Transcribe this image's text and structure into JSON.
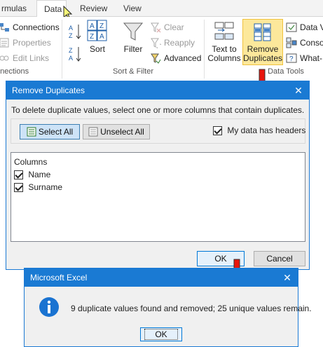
{
  "ribbon": {
    "tabs": [
      {
        "label": "rmulas"
      },
      {
        "label": "Data"
      },
      {
        "label": "Review"
      },
      {
        "label": "View"
      }
    ],
    "connections_group": {
      "items": [
        "Connections",
        "Properties",
        "Edit Links"
      ],
      "label": "nnections"
    },
    "sort_filter_group": {
      "sort_label": "Sort",
      "filter_label": "Filter",
      "clear_label": "Clear",
      "reapply_label": "Reapply",
      "advanced_label": "Advanced",
      "label": "Sort & Filter"
    },
    "data_tools_group": {
      "text_to_columns_line1": "Text to",
      "text_to_columns_line2": "Columns",
      "remove_duplicates_line1": "Remove",
      "remove_duplicates_line2": "Duplicates",
      "right_items": [
        "Data V",
        "Conso",
        "What-I"
      ],
      "label": "Data Tools"
    }
  },
  "remove_dialog": {
    "title": "Remove Duplicates",
    "instruction": "To delete duplicate values, select one or more columns that contain duplicates.",
    "select_all_label": "Select All",
    "unselect_all_label": "Unselect All",
    "headers_checkbox_label": "My data has headers",
    "headers_checked": true,
    "columns_header": "Columns",
    "columns": [
      {
        "label": "Name",
        "checked": true
      },
      {
        "label": "Surname",
        "checked": true
      }
    ],
    "ok_label": "OK",
    "cancel_label": "Cancel"
  },
  "message_box": {
    "title": "Microsoft Excel",
    "message": "9 duplicate values found and removed; 25 unique values remain.",
    "ok_label": "OK",
    "icon": "info-icon"
  },
  "colors": {
    "accent": "#1a7ad3",
    "highlight": "#fce89b",
    "arrow": "#e8140c"
  }
}
